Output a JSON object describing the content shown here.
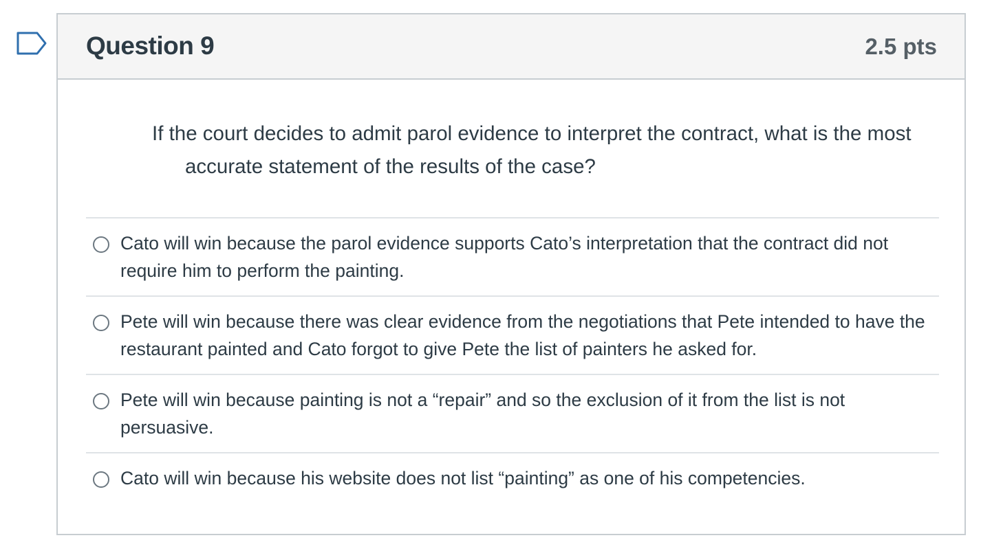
{
  "question": {
    "title": "Question 9",
    "points": "2.5 pts",
    "text": "If the court decides to admit parol evidence to interpret the contract, what is the most accurate statement of the results of the case?",
    "flag_icon": "bookmark-flag-icon"
  },
  "answers": [
    {
      "label": "Cato will win because the parol evidence supports Cato’s interpretation that the contract did not require him to perform the painting."
    },
    {
      "label": "Pete will win because there was clear evidence from the negotiations that Pete intended to have the restaurant painted and Cato forgot to give Pete the list of painters he asked for."
    },
    {
      "label": "Pete will win because painting is not a “repair” and so the exclusion of it from the list is not persuasive."
    },
    {
      "label": "Cato will win because his website does not list “painting” as one of his competencies."
    }
  ],
  "colors": {
    "header_bg": "#f5f5f5",
    "border": "#c7cdd1",
    "text": "#2d3b45",
    "flag": "#2f6fae"
  }
}
